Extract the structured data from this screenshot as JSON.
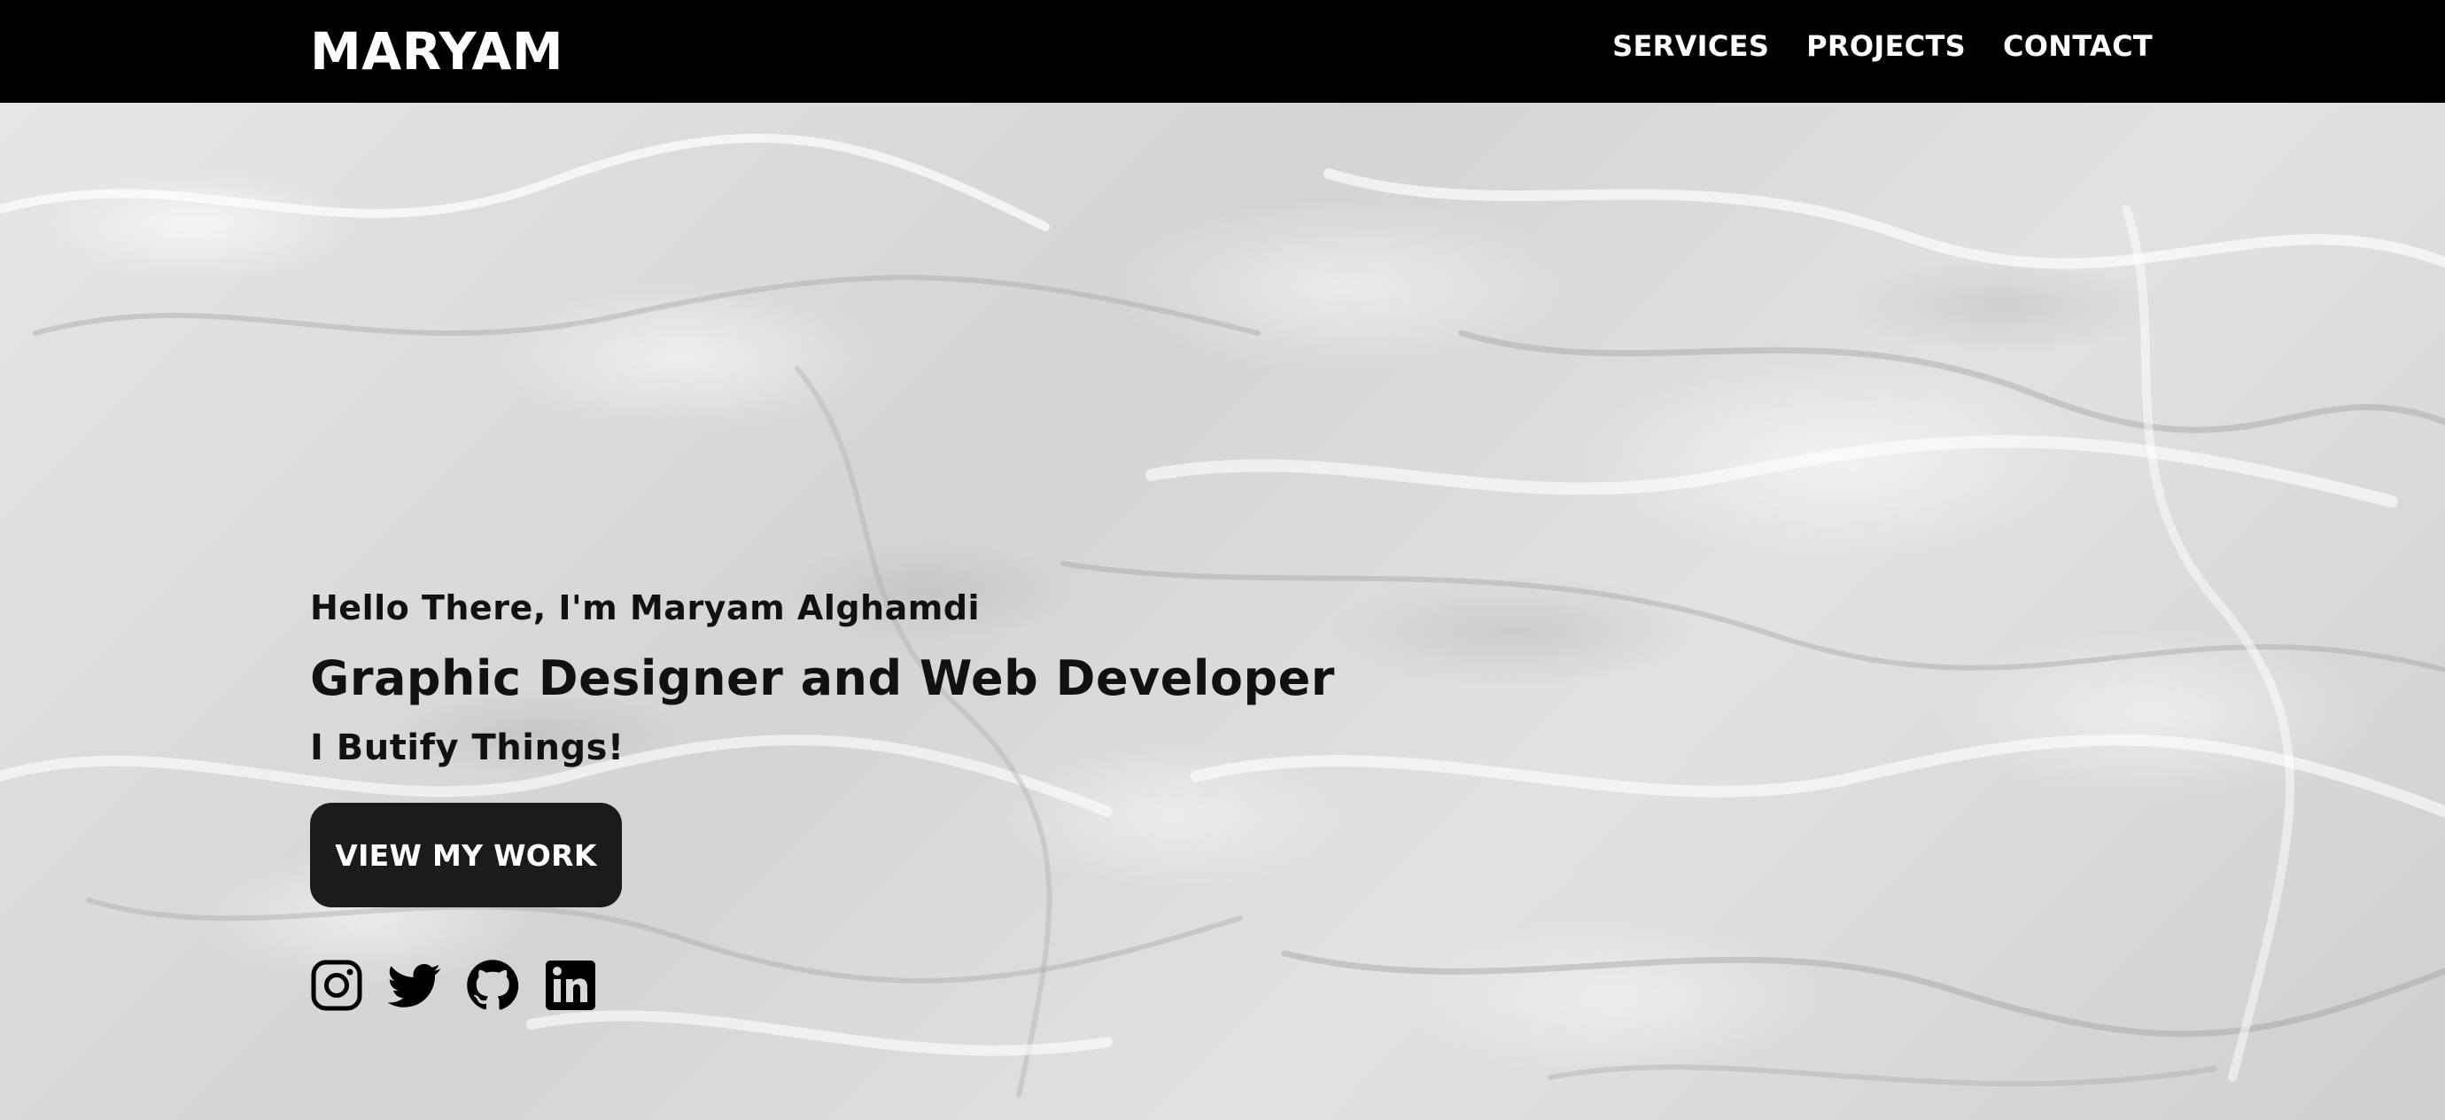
{
  "navbar": {
    "brand": "MARYAM",
    "links": [
      {
        "label": "SERVICES"
      },
      {
        "label": "PROJECTS"
      },
      {
        "label": "CONTACT"
      }
    ]
  },
  "hero": {
    "greeting": "Hello There, I'm Maryam Alghamdi",
    "headline": "Graphic Designer and Web Developer",
    "tagline": "I Butify Things!",
    "cta_label": "VIEW MY WORK",
    "social": [
      {
        "icon": "instagram-icon"
      },
      {
        "icon": "twitter-icon"
      },
      {
        "icon": "github-icon"
      },
      {
        "icon": "linkedin-icon"
      }
    ]
  },
  "colors": {
    "navbar_bg": "#000000",
    "nav_text": "#ffffff",
    "hero_text": "#111111",
    "button_bg": "#1b1b1b",
    "button_text": "#ffffff",
    "background_texture": "#d9d9d9"
  }
}
